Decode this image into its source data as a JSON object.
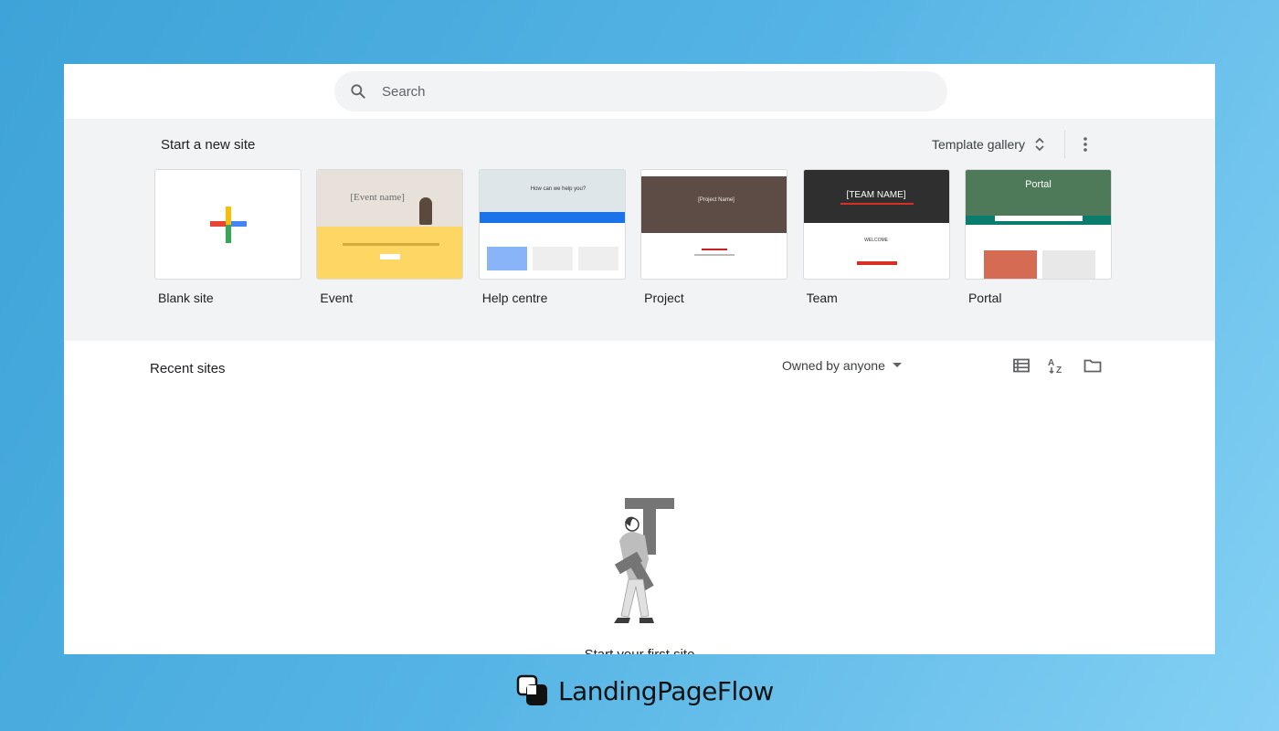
{
  "search": {
    "placeholder": "Search"
  },
  "new_site": {
    "title": "Start a new site",
    "gallery_label": "Template gallery",
    "templates": [
      {
        "label": "Blank site"
      },
      {
        "label": "Event",
        "thumb_title": "[Event name]"
      },
      {
        "label": "Help centre",
        "thumb_title": "How can we help you?"
      },
      {
        "label": "Project",
        "thumb_title": "[Project Name]"
      },
      {
        "label": "Team",
        "thumb_title": "[TEAM NAME]",
        "thumb_sub": "WELCOME"
      },
      {
        "label": "Portal",
        "thumb_title": "Portal"
      }
    ]
  },
  "recent": {
    "title": "Recent sites",
    "owner_filter": "Owned by anyone",
    "empty_text": "Start your first site"
  },
  "icons": [
    "search-icon",
    "sort-arrows-icon",
    "more-vert-icon",
    "list-view-icon",
    "sort-az-icon",
    "folder-icon",
    "dropdown-arrow-icon",
    "brand-logo-icon"
  ],
  "brand": {
    "name": "LandingPageFlow"
  },
  "colors": {
    "google_blue": "#4285f4",
    "google_red": "#ea4335",
    "google_yellow": "#fbbc04",
    "google_green": "#34a853",
    "panel_bg": "#f1f3f4"
  }
}
